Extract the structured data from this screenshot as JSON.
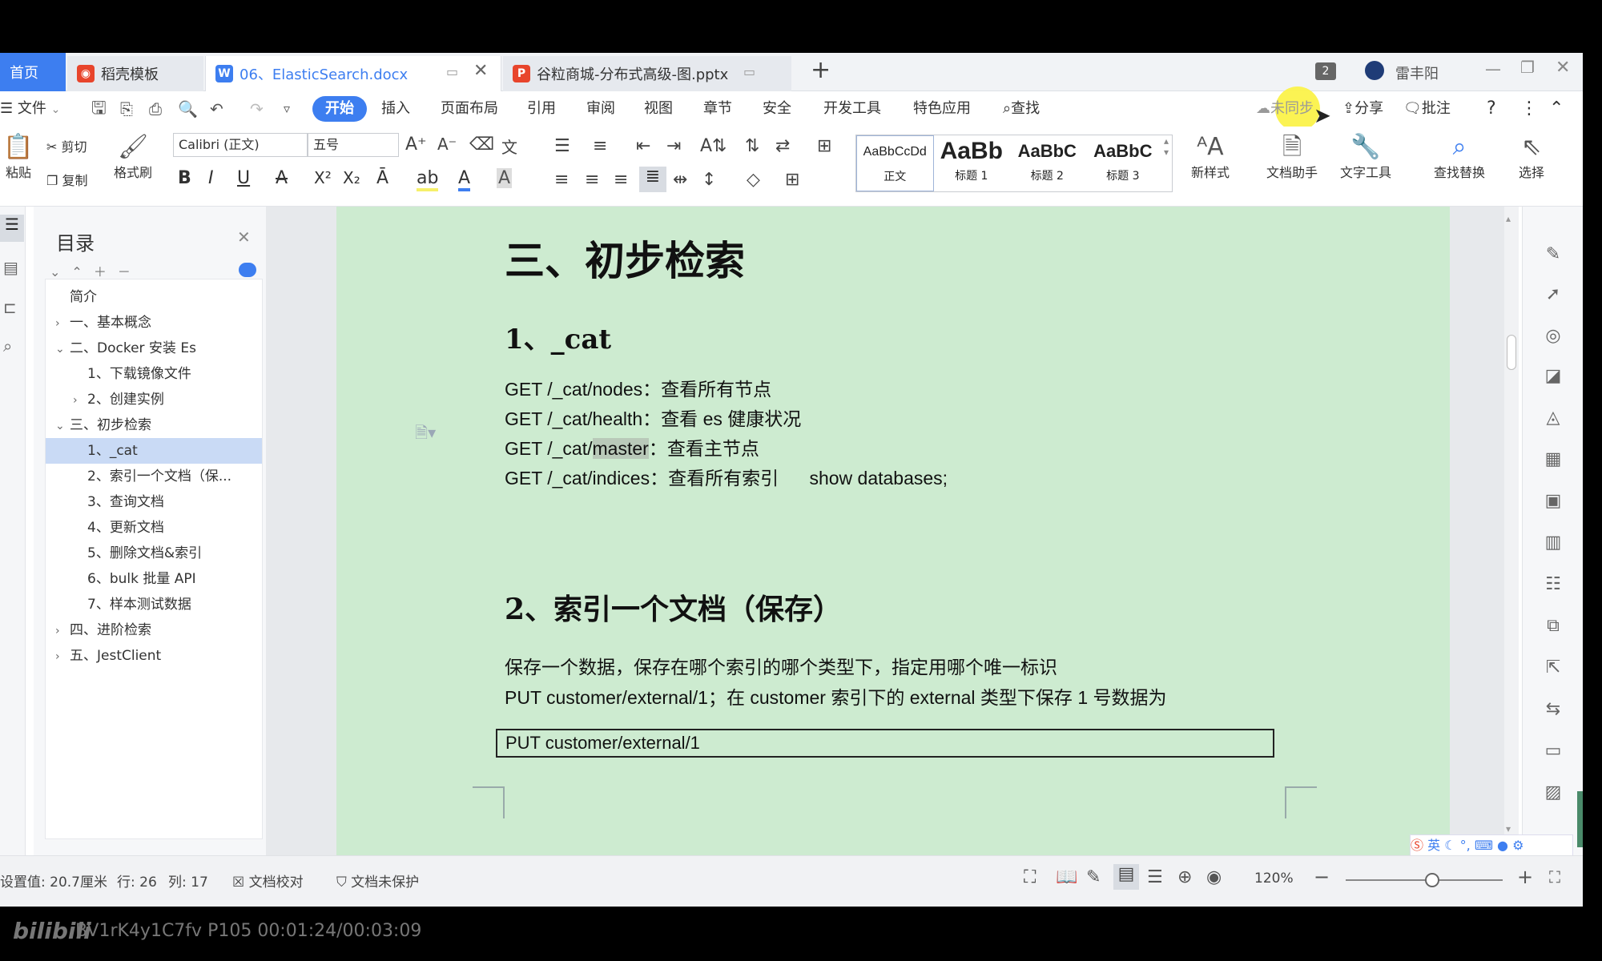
{
  "tabs": {
    "home": "首页",
    "template": "稻壳模板",
    "doc": "06、ElasticSearch.docx",
    "ppt": "谷粒商城-分布式高级-图.pptx",
    "new_tab": "+",
    "window_count": "2",
    "user": "雷丰阳"
  },
  "menu": {
    "file": "文件",
    "items": [
      "开始",
      "插入",
      "页面布局",
      "引用",
      "审阅",
      "视图",
      "章节",
      "安全",
      "开发工具",
      "特色应用"
    ],
    "search": "查找",
    "sync": "未同步",
    "share": "分享",
    "annotate": "批注"
  },
  "ribbon": {
    "paste": "粘贴",
    "cut": "剪切",
    "copy": "复制",
    "format_painter": "格式刷",
    "font_name": "Calibri (正文)",
    "font_size": "五号",
    "styles": [
      {
        "preview": "AaBbCcDd",
        "label": "正文"
      },
      {
        "preview": "AaBb",
        "label": "标题 1"
      },
      {
        "preview": "AaBbC",
        "label": "标题 2"
      },
      {
        "preview": "AaBbC",
        "label": "标题 3"
      }
    ],
    "new_style": "新样式",
    "doc_helper": "文档助手",
    "text_tools": "文字工具",
    "find_replace": "查找替换",
    "select": "选择"
  },
  "nav": {
    "title": "目录",
    "items": [
      {
        "label": "简介",
        "chev": "",
        "indent": 0
      },
      {
        "label": "一、基本概念",
        "chev": "›",
        "indent": 0
      },
      {
        "label": "二、Docker 安装 Es",
        "chev": "⌄",
        "indent": 0
      },
      {
        "label": "1、下载镜像文件",
        "chev": "",
        "indent": 1
      },
      {
        "label": "2、创建实例",
        "chev": "›",
        "indent": 1
      },
      {
        "label": "三、初步检索",
        "chev": "⌄",
        "indent": 0
      },
      {
        "label": "1、_cat",
        "chev": "",
        "indent": 1,
        "selected": true
      },
      {
        "label": "2、索引一个文档（保...",
        "chev": "",
        "indent": 1
      },
      {
        "label": "3、查询文档",
        "chev": "",
        "indent": 1
      },
      {
        "label": "4、更新文档",
        "chev": "",
        "indent": 1
      },
      {
        "label": "5、删除文档&索引",
        "chev": "",
        "indent": 1
      },
      {
        "label": "6、bulk 批量 API",
        "chev": "",
        "indent": 1
      },
      {
        "label": "7、样本测试数据",
        "chev": "",
        "indent": 1
      },
      {
        "label": "四、进阶检索",
        "chev": "›",
        "indent": 0
      },
      {
        "label": "五、JestClient",
        "chev": "›",
        "indent": 0
      }
    ]
  },
  "doc": {
    "h1": "三、初步检索",
    "h2_cat": "1、_cat",
    "cat_lines": [
      {
        "pre": "GET /_cat/nodes：查看所有节点",
        "hl": "",
        "post": ""
      },
      {
        "pre": "GET /_cat/health：查看 es 健康状况",
        "hl": "",
        "post": ""
      },
      {
        "pre": "GET /_cat/",
        "hl": "master",
        "post": "：查看主节点"
      },
      {
        "pre": "GET /_cat/indices：查看所有索引",
        "hl": "",
        "post": "      show databases;"
      }
    ],
    "h2_index": "2、索引一个文档（保存）",
    "para1": "保存一个数据，保存在哪个索引的哪个类型下，指定用哪个唯一标识",
    "para2": "PUT customer/external/1；在 customer 索引下的 external 类型下保存 1 号数据为",
    "code": "PUT customer/external/1"
  },
  "status": {
    "position": "设置值: 20.7厘米",
    "row": "行: 26",
    "col": "列: 17",
    "proof": "文档校对",
    "protect": "文档未保护",
    "zoom": "120%",
    "zoom_level": 0.55
  },
  "ime": "英",
  "footer": "BV1rK4y1C7fv P105 00:01:24/00:03:09",
  "footer_logo": "bilibili",
  "colors": {
    "accent": "#3d7ef0",
    "page": "#cdebd0",
    "highlight": "#f6f06a"
  }
}
